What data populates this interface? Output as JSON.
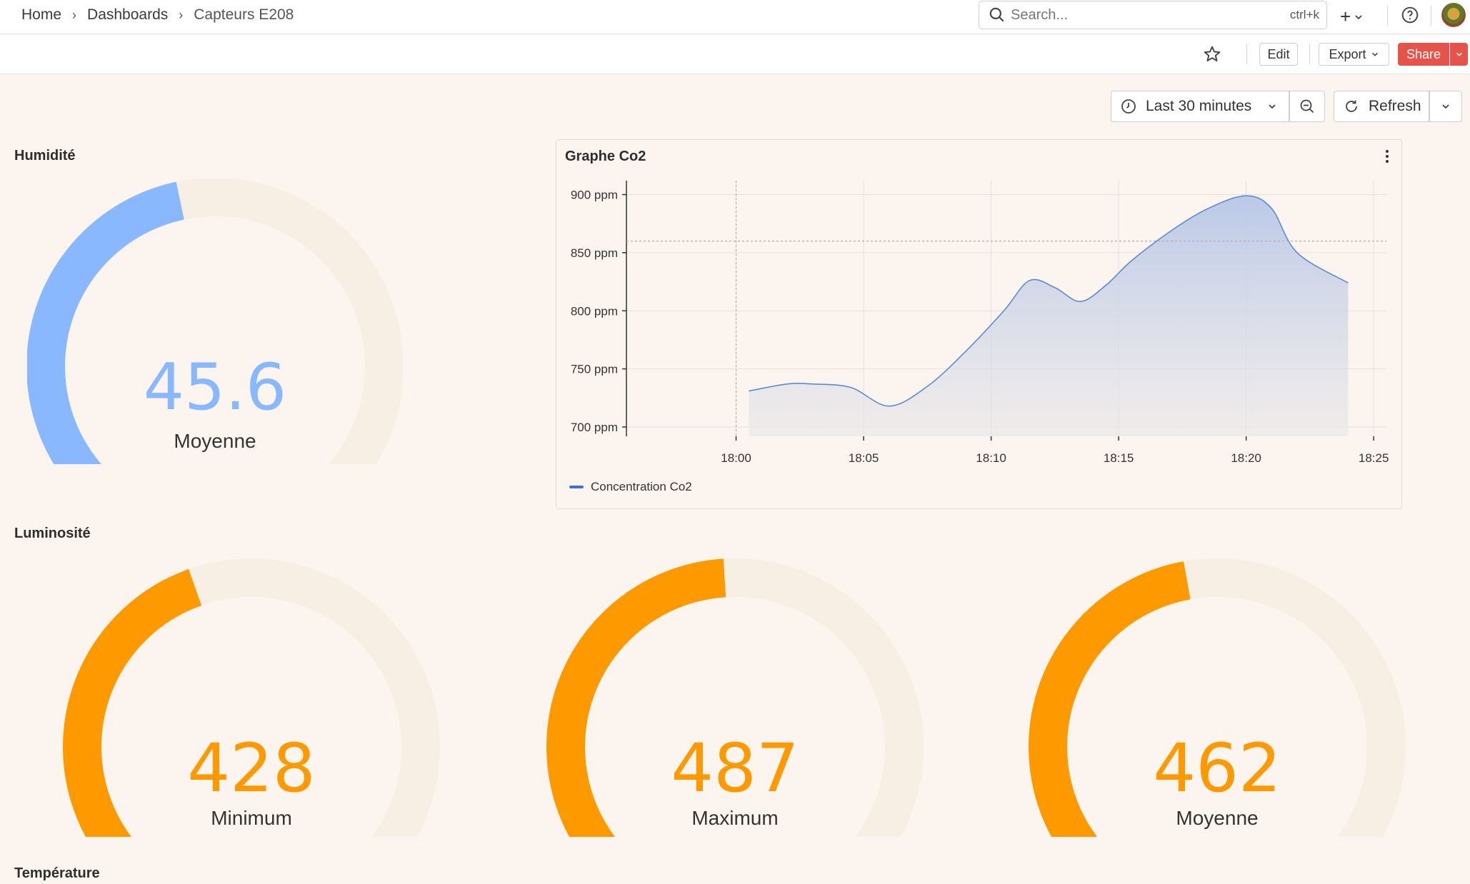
{
  "breadcrumb": {
    "home": "Home",
    "dashboards": "Dashboards",
    "current": "Capteurs E208"
  },
  "search": {
    "placeholder": "Search...",
    "shortcut": "ctrl+k"
  },
  "toolbar": {
    "edit": "Edit",
    "export": "Export",
    "share": "Share"
  },
  "timepicker": {
    "range": "Last 30 minutes",
    "refresh": "Refresh"
  },
  "colors": {
    "humidity_gauge": "#8ab8ff",
    "luminosity_gauge": "#ff9900",
    "gauge_track": "#f7efe4",
    "series": "#5b8bd6",
    "accent": "#e5534b"
  },
  "panels": {
    "humidite": {
      "title": "Humidité",
      "value": "45.6",
      "label": "Moyenne",
      "fill": 0.456
    },
    "co2": {
      "title": "Graphe Co2",
      "legend": "Concentration Co2"
    },
    "luminosite": {
      "title": "Luminosité",
      "gauges": [
        {
          "value": "428",
          "label": "Minimum",
          "fill": 0.428
        },
        {
          "value": "487",
          "label": "Maximum",
          "fill": 0.487
        },
        {
          "value": "462",
          "label": "Moyenne",
          "fill": 0.462
        }
      ]
    },
    "temperature": {
      "title": "Température"
    }
  },
  "chart_data": {
    "type": "area",
    "title": "Graphe Co2",
    "xlabel": "",
    "ylabel": "",
    "x_ticks": [
      "18:00",
      "18:05",
      "18:10",
      "18:15",
      "18:20",
      "18:25"
    ],
    "y_ticks": [
      "700 ppm",
      "750 ppm",
      "800 ppm",
      "850 ppm",
      "900 ppm"
    ],
    "ylim": [
      692,
      912
    ],
    "xlim_minutes": [
      -4.3,
      25.5
    ],
    "grid": true,
    "series": [
      {
        "name": "Concentration Co2",
        "x_minutes": [
          0.5,
          2,
          3,
          4.5,
          6,
          7.5,
          9,
          10.5,
          11.5,
          12.5,
          13.5,
          14.5,
          15.5,
          17,
          18.5,
          20,
          21,
          22,
          24
        ],
        "values": [
          731,
          737,
          737,
          734,
          718,
          735,
          765,
          800,
          826,
          820,
          808,
          822,
          843,
          868,
          888,
          899,
          888,
          850,
          824
        ]
      }
    ],
    "reference_line": 860,
    "cursor_x_minutes": 0
  }
}
